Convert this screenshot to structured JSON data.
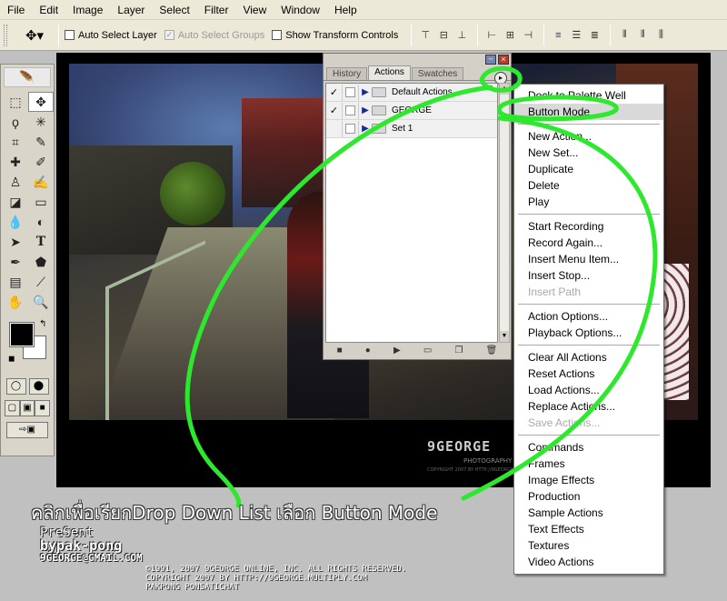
{
  "menubar": {
    "items": [
      "File",
      "Edit",
      "Image",
      "Layer",
      "Select",
      "Filter",
      "View",
      "Window",
      "Help"
    ]
  },
  "options": {
    "auto_select_layer": "Auto Select Layer",
    "auto_select_groups": "Auto Select Groups",
    "show_transform": "Show Transform Controls"
  },
  "palette": {
    "tabs": [
      "History",
      "Actions",
      "Swatches"
    ],
    "active_tab": "Actions",
    "actions": [
      {
        "name": "Default Actions",
        "checked": true
      },
      {
        "name": "GEORGE",
        "checked": true
      },
      {
        "name": "Set 1",
        "checked": false
      }
    ]
  },
  "dropdown": {
    "groups": [
      [
        "Dock to Palette Well",
        "Button Mode"
      ],
      [
        "New Action...",
        "New Set...",
        "Duplicate",
        "Delete",
        "Play"
      ],
      [
        "Start Recording",
        "Record Again...",
        "Insert Menu Item...",
        "Insert Stop...",
        "Insert Path"
      ],
      [
        "Action Options...",
        "Playback Options..."
      ],
      [
        "Clear All Actions",
        "Reset Actions",
        "Load Actions...",
        "Replace Actions...",
        "Save Actions..."
      ],
      [
        "Commands",
        "Frames",
        "Image Effects",
        "Production",
        "Sample Actions",
        "Text Effects",
        "Textures",
        "Video Actions"
      ]
    ],
    "highlighted": "Button Mode",
    "disabled": [
      "Insert Path",
      "Save Actions..."
    ]
  },
  "photo_logo": {
    "name": "9GEORGE",
    "sub": "PHOTOGRAPHY",
    "fine": "COPYRIGHT 2007 BY HTTP://9GEORGE.MULTIPLY.COM"
  },
  "caption": "คลิกเพื่อเรียกDrop Down List เลือก Button Mode",
  "presenter": {
    "line1": "PreSent",
    "line2": "bypak-pong",
    "line3": "9GEORGE@GMAIL.COM"
  },
  "copyright": [
    "©1991, 2007 9GEORGE ONLINE, INC. ALL RIGHTS RESERVED.",
    "COPYRIGHT 2007 BY   HTTP://9GEORGE.MULTIPLY.COM",
    "PAKPONG PONSATICHAT"
  ],
  "colors": {
    "accent_green": "#2ee82e",
    "foreground": "#000000",
    "background": "#ffffff"
  }
}
